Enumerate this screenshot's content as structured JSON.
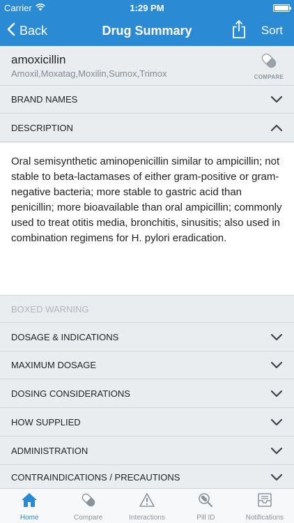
{
  "status": {
    "carrier": "Carrier",
    "time": "1:29 PM"
  },
  "nav": {
    "back_label": "Back",
    "title": "Drug Summary",
    "sort_label": "Sort"
  },
  "drug": {
    "name": "amoxicillin",
    "brands": "Amoxil,Moxatag,Moxilin,Sumox,Trimox",
    "compare_label": "COMPARE"
  },
  "sections": {
    "brand_names": "BRAND NAMES",
    "description": "DESCRIPTION",
    "description_text": "Oral semisynthetic aminopenicillin similar to ampicillin; not stable to beta-lactamases of either gram-positive or gram-negative bacteria; more stable to gastric acid than penicillin; more bioavailable than oral ampicillin; commonly used to treat otitis media, bronchitis, sinusitis; also used in combination regimens for H. pylori eradication.",
    "boxed_warning": "BOXED WARNING",
    "dosage_indications": "DOSAGE & INDICATIONS",
    "maximum_dosage": "MAXIMUM DOSAGE",
    "dosing_considerations": "DOSING CONSIDERATIONS",
    "how_supplied": "HOW SUPPLIED",
    "administration": "ADMINISTRATION",
    "contraindications": "CONTRAINDICATIONS / PRECAUTIONS"
  },
  "tabs": [
    {
      "label": "Home",
      "icon": "home-icon",
      "active": true
    },
    {
      "label": "Compare",
      "icon": "pill-icon",
      "active": false
    },
    {
      "label": "Interactions",
      "icon": "warning-icon",
      "active": false
    },
    {
      "label": "Pill ID",
      "icon": "pill-magnifier-icon",
      "active": false
    },
    {
      "label": "Notifications",
      "icon": "notifications-icon",
      "active": false
    }
  ],
  "colors": {
    "accent": "#2a8bd4",
    "background": "#e9edf0",
    "divider": "#cfd5da"
  }
}
